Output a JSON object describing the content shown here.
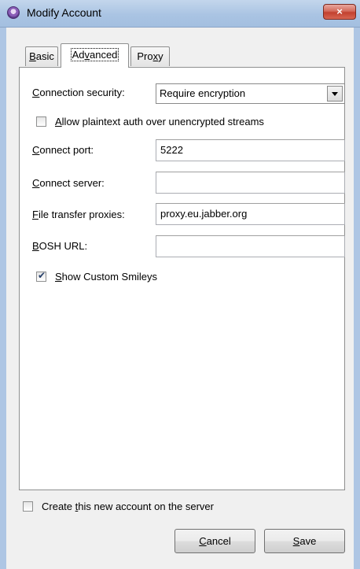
{
  "window": {
    "title": "Modify Account",
    "close_glyph": "×"
  },
  "tabs": [
    {
      "pre": "",
      "key": "B",
      "post": "asic",
      "active": false
    },
    {
      "pre": "Ad",
      "key": "v",
      "post": "anced",
      "active": true
    },
    {
      "pre": "Pro",
      "key": "x",
      "post": "y",
      "active": false
    }
  ],
  "advanced": {
    "connection_security": {
      "pre": "",
      "key": "C",
      "post": "onnection security:",
      "value": "Require encryption"
    },
    "allow_plaintext": {
      "pre": "",
      "key": "A",
      "post": "llow plaintext auth over unencrypted streams",
      "checked": false
    },
    "connect_port": {
      "pre": "",
      "key": "C",
      "post": "onnect port:",
      "value": "5222"
    },
    "connect_server": {
      "pre": "",
      "key": "C",
      "post": "onnect server:",
      "value": ""
    },
    "file_transfer_proxies": {
      "pre": "",
      "key": "F",
      "post": "ile transfer proxies:",
      "value": "proxy.eu.jabber.org"
    },
    "bosh_url": {
      "pre": "",
      "key": "B",
      "post": "OSH URL:",
      "value": ""
    },
    "show_custom_smileys": {
      "pre": "",
      "key": "S",
      "post": "how Custom Smileys",
      "checked": true
    }
  },
  "footer": {
    "create_account": {
      "pre": "Create ",
      "key": "t",
      "post": "his new account on the server",
      "checked": false
    },
    "cancel": {
      "pre": "",
      "key": "C",
      "post": "ancel"
    },
    "save": {
      "pre": "",
      "key": "S",
      "post": "ave"
    }
  },
  "colors": {
    "titlebar": "#aac4e3",
    "close_button": "#c94b3b",
    "client_bg": "#f0f0f0"
  }
}
